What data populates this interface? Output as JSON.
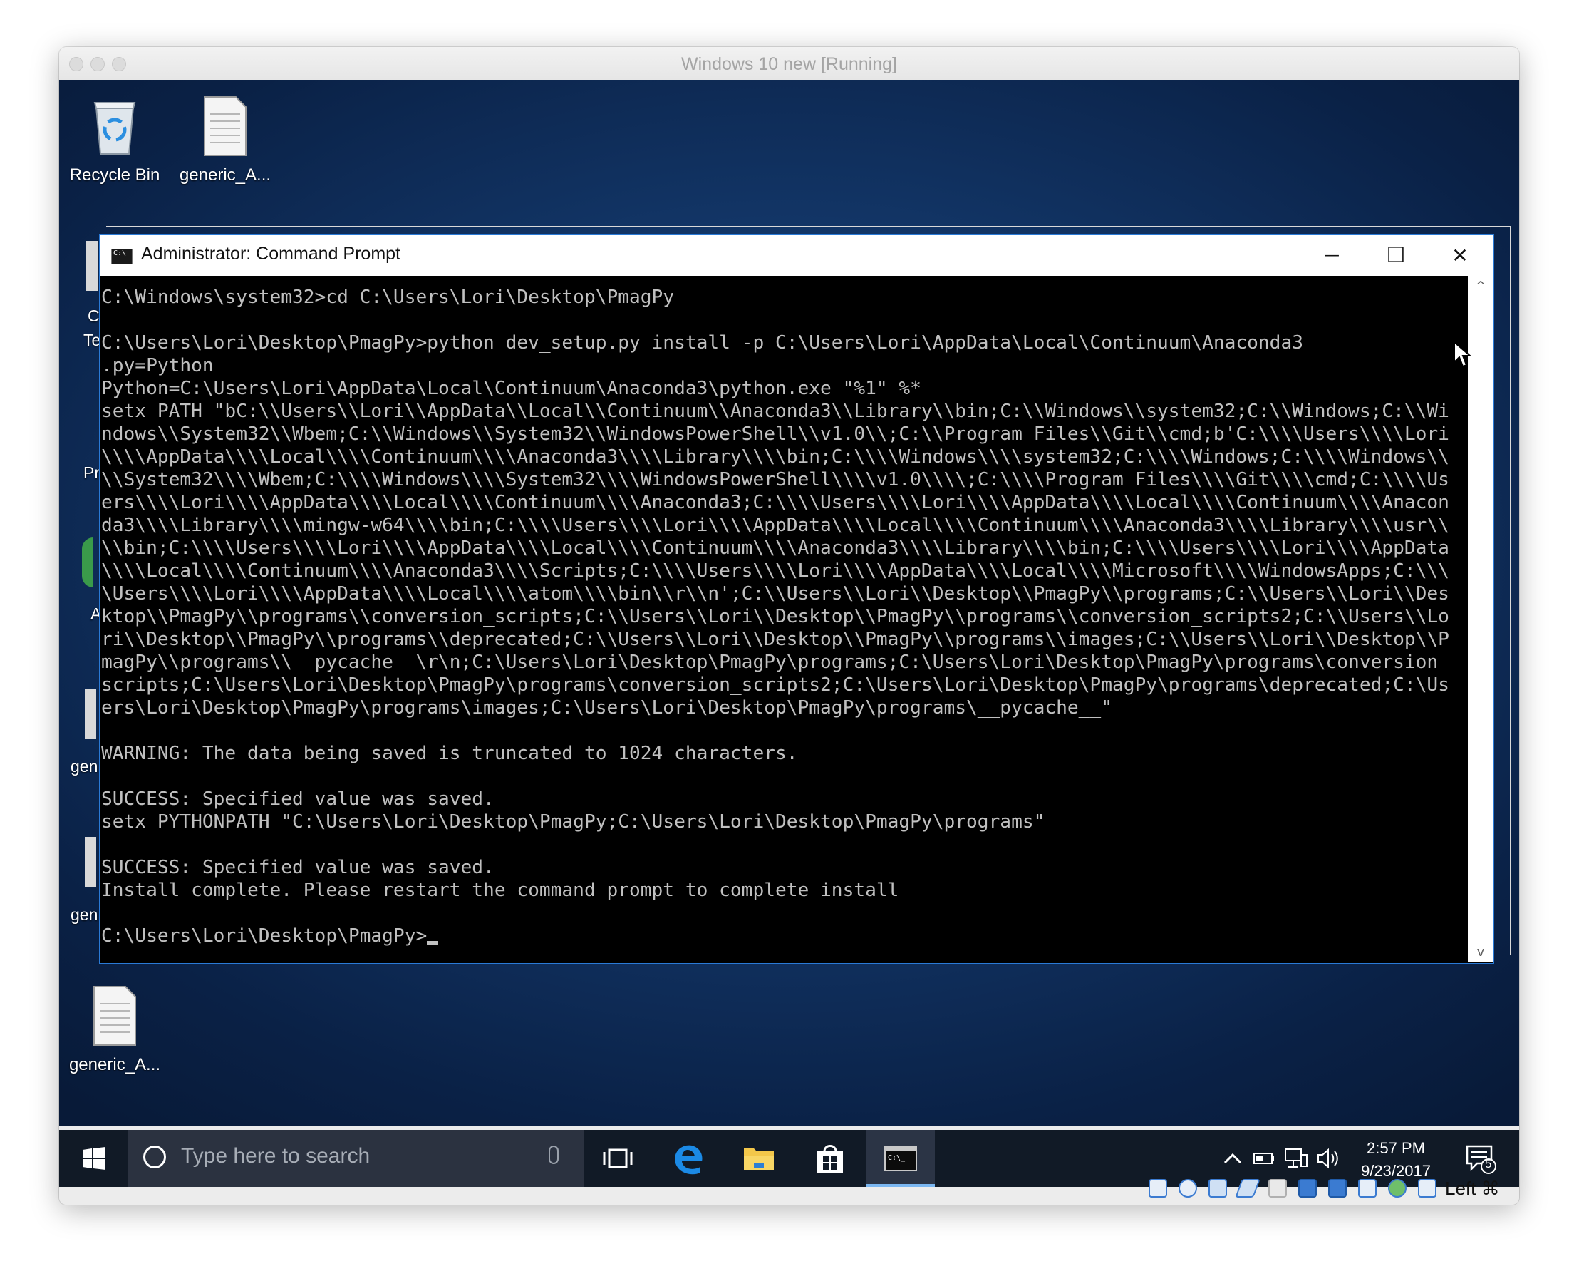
{
  "host_window": {
    "title": "Windows 10 new [Running]"
  },
  "desktop": {
    "icons": [
      {
        "label": "Recycle Bin",
        "icon": "recycle-bin-icon"
      },
      {
        "label": "generic_A...",
        "icon": "document-icon"
      },
      {
        "label": "generic_A...",
        "icon": "document-icon"
      }
    ],
    "partial_labels": [
      "C",
      "Te",
      "Pr",
      "A",
      "gen",
      "gen"
    ]
  },
  "cmd_window": {
    "title": "Administrator: Command Prompt",
    "minimize_glyph": "—",
    "maximize_glyph": "☐",
    "close_glyph": "✕",
    "lines": [
      "C:\\Windows\\system32>cd C:\\Users\\Lori\\Desktop\\PmagPy",
      "",
      "C:\\Users\\Lori\\Desktop\\PmagPy>python dev_setup.py install -p C:\\Users\\Lori\\AppData\\Local\\Continuum\\Anaconda3",
      ".py=Python",
      "Python=C:\\Users\\Lori\\AppData\\Local\\Continuum\\Anaconda3\\python.exe \"%1\" %*",
      "setx PATH \"bC:\\\\Users\\\\Lori\\\\AppData\\\\Local\\\\Continuum\\\\Anaconda3\\\\Library\\\\bin;C:\\\\Windows\\\\system32;C:\\\\Windows;C:\\\\Wi",
      "ndows\\\\System32\\\\Wbem;C:\\\\Windows\\\\System32\\\\WindowsPowerShell\\\\v1.0\\\\;C:\\\\Program Files\\\\Git\\\\cmd;b'C:\\\\\\\\Users\\\\\\\\Lori",
      "\\\\\\\\AppData\\\\\\\\Local\\\\\\\\Continuum\\\\\\\\Anaconda3\\\\\\\\Library\\\\\\\\bin;C:\\\\\\\\Windows\\\\\\\\system32;C:\\\\\\\\Windows;C:\\\\\\\\Windows\\\\",
      "\\\\System32\\\\\\\\Wbem;C:\\\\\\\\Windows\\\\\\\\System32\\\\\\\\WindowsPowerShell\\\\\\\\v1.0\\\\\\\\;C:\\\\\\\\Program Files\\\\\\\\Git\\\\\\\\cmd;C:\\\\\\\\Us",
      "ers\\\\\\\\Lori\\\\\\\\AppData\\\\\\\\Local\\\\\\\\Continuum\\\\\\\\Anaconda3;C:\\\\\\\\Users\\\\\\\\Lori\\\\\\\\AppData\\\\\\\\Local\\\\\\\\Continuum\\\\\\\\Anacon",
      "da3\\\\\\\\Library\\\\\\\\mingw-w64\\\\\\\\bin;C:\\\\\\\\Users\\\\\\\\Lori\\\\\\\\AppData\\\\\\\\Local\\\\\\\\Continuum\\\\\\\\Anaconda3\\\\\\\\Library\\\\\\\\usr\\\\",
      "\\\\bin;C:\\\\\\\\Users\\\\\\\\Lori\\\\\\\\AppData\\\\\\\\Local\\\\\\\\Continuum\\\\\\\\Anaconda3\\\\\\\\Library\\\\\\\\bin;C:\\\\\\\\Users\\\\\\\\Lori\\\\\\\\AppData",
      "\\\\\\\\Local\\\\\\\\Continuum\\\\\\\\Anaconda3\\\\\\\\Scripts;C:\\\\\\\\Users\\\\\\\\Lori\\\\\\\\AppData\\\\\\\\Local\\\\\\\\Microsoft\\\\\\\\WindowsApps;C:\\\\\\",
      "\\Users\\\\\\\\Lori\\\\\\\\AppData\\\\\\\\Local\\\\\\\\atom\\\\\\\\bin\\\\r\\\\n';C:\\\\Users\\\\Lori\\\\Desktop\\\\PmagPy\\\\programs;C:\\\\Users\\\\Lori\\\\Des",
      "ktop\\\\PmagPy\\\\programs\\\\conversion_scripts;C:\\\\Users\\\\Lori\\\\Desktop\\\\PmagPy\\\\programs\\\\conversion_scripts2;C:\\\\Users\\\\Lo",
      "ri\\\\Desktop\\\\PmagPy\\\\programs\\\\deprecated;C:\\\\Users\\\\Lori\\\\Desktop\\\\PmagPy\\\\programs\\\\images;C:\\\\Users\\\\Lori\\\\Desktop\\\\P",
      "magPy\\\\programs\\\\__pycache__\\r\\n;C:\\Users\\Lori\\Desktop\\PmagPy\\programs;C:\\Users\\Lori\\Desktop\\PmagPy\\programs\\conversion_",
      "scripts;C:\\Users\\Lori\\Desktop\\PmagPy\\programs\\conversion_scripts2;C:\\Users\\Lori\\Desktop\\PmagPy\\programs\\deprecated;C:\\Us",
      "ers\\Lori\\Desktop\\PmagPy\\programs\\images;C:\\Users\\Lori\\Desktop\\PmagPy\\programs\\__pycache__\"",
      "",
      "WARNING: The data being saved is truncated to 1024 characters.",
      "",
      "SUCCESS: Specified value was saved.",
      "setx PYTHONPATH \"C:\\Users\\Lori\\Desktop\\PmagPy;C:\\Users\\Lori\\Desktop\\PmagPy\\programs\"",
      "",
      "SUCCESS: Specified value was saved.",
      "Install complete. Please restart the command prompt to complete install",
      ""
    ],
    "prompt": "C:\\Users\\Lori\\Desktop\\PmagPy>"
  },
  "taskbar": {
    "search_placeholder": "Type here to search",
    "buttons": [
      "start-icon",
      "task-view-icon",
      "edge-icon",
      "file-explorer-icon",
      "store-icon",
      "command-prompt-icon"
    ],
    "tray_icons": [
      "chevron-up-icon",
      "battery-icon",
      "network-icon",
      "volume-icon"
    ],
    "time": "2:57 PM",
    "date": "9/23/2017",
    "notification_count": "5"
  },
  "vbox_status": {
    "host_key": "Left ⌘",
    "icons": [
      "hard-disk-icon",
      "optical-drive-icon",
      "audio-icon",
      "network-adapter-icon",
      "usb-icon",
      "shared-folder-icon",
      "display-icon",
      "recording-icon",
      "cpu-icon",
      "mouse-integration-icon",
      "arrow-down-icon"
    ]
  },
  "colors": {
    "desktop": "#123566",
    "taskbar": "#111a26",
    "console_bg": "#000000",
    "console_fg": "#c0c0c0",
    "cmd_border": "#2a7ad6"
  }
}
